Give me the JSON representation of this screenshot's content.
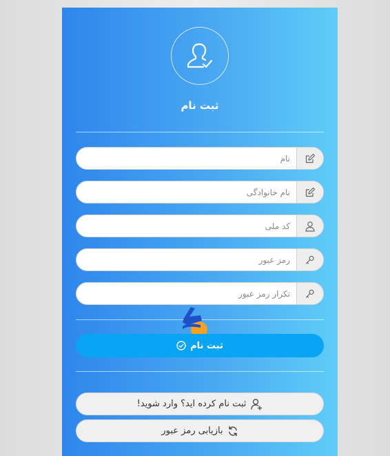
{
  "form": {
    "title": "ثبت نام",
    "fields": [
      {
        "name": "first-name",
        "placeholder": "نام",
        "icon": "edit-icon"
      },
      {
        "name": "last-name",
        "placeholder": "نام خانوادگی",
        "icon": "edit-icon"
      },
      {
        "name": "national-code",
        "placeholder": "کد ملی",
        "icon": "user-icon"
      },
      {
        "name": "password",
        "placeholder": "رمز عبور",
        "icon": "key-icon"
      },
      {
        "name": "password-confirm",
        "placeholder": "تکرار رمز عبور",
        "icon": "key-icon"
      }
    ],
    "submit_label": "ثبت نام",
    "login_link_label": "ثبت نام کرده اید؟ وارد شوید!",
    "recover_link_label": "بازیابی رمز عبور"
  },
  "colors": {
    "gradient_start": "#2e86ec",
    "gradient_end": "#5fcdf8",
    "submit_button": "#0aa4f5",
    "logo_blue": "#2050c8",
    "logo_orange": "#f5a020"
  }
}
